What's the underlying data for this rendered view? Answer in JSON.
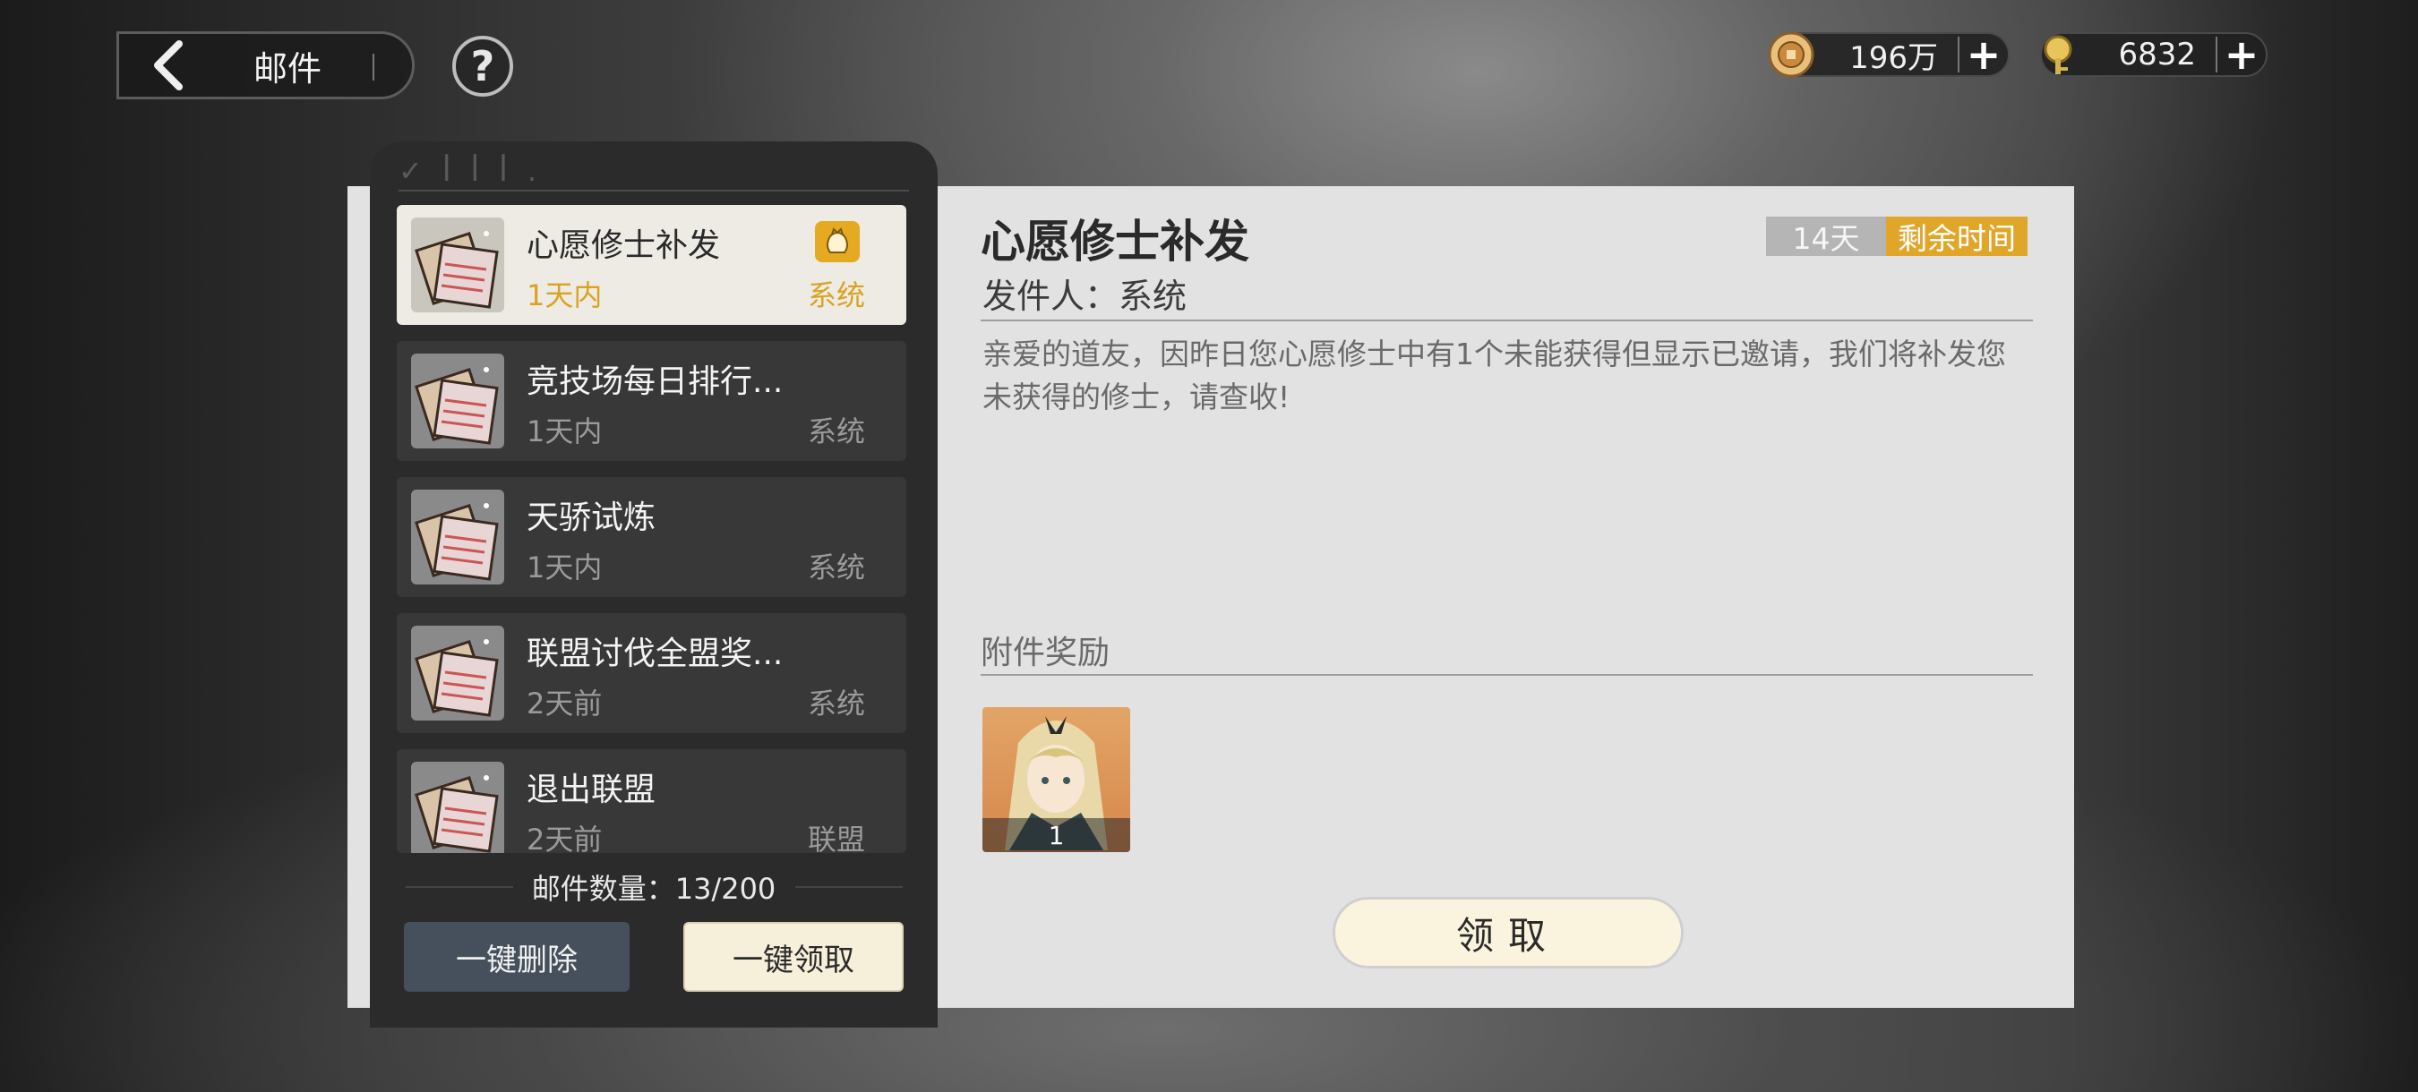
{
  "header": {
    "title": "邮件",
    "help_label": "?"
  },
  "currencies": [
    {
      "icon": "coin-icon",
      "value": "196万"
    },
    {
      "icon": "key-token-icon",
      "value": "6832"
    }
  ],
  "mail_list": {
    "items": [
      {
        "title": "心愿修士补发",
        "time": "1天内",
        "type": "系统",
        "active": true
      },
      {
        "title": "竞技场每日排行...",
        "time": "1天内",
        "type": "系统",
        "active": false
      },
      {
        "title": "天骄试炼",
        "time": "1天内",
        "type": "系统",
        "active": false
      },
      {
        "title": "联盟讨伐全盟奖...",
        "time": "2天前",
        "type": "系统",
        "active": false
      },
      {
        "title": "退出联盟",
        "time": "2天前",
        "type": "联盟",
        "active": false
      }
    ],
    "count_text": "邮件数量：13/200",
    "delete_all_label": "一键删除",
    "claim_all_label": "一键领取"
  },
  "detail": {
    "title": "心愿修士补发",
    "sender": "发件人：系统",
    "timer_days": "14天",
    "timer_label": "剩余时间",
    "body": "亲爱的道友，因昨日您心愿修士中有1个未能获得但显示已邀请，我们将补发您未获得的修士，请查收!",
    "attachment_title": "附件奖励",
    "attachment_qty": "1",
    "claim_label": "领取"
  },
  "colors": {
    "accent_gold": "#e0a62a",
    "panel_bg": "#e2e2e2",
    "list_bg": "#2b2b2b"
  }
}
